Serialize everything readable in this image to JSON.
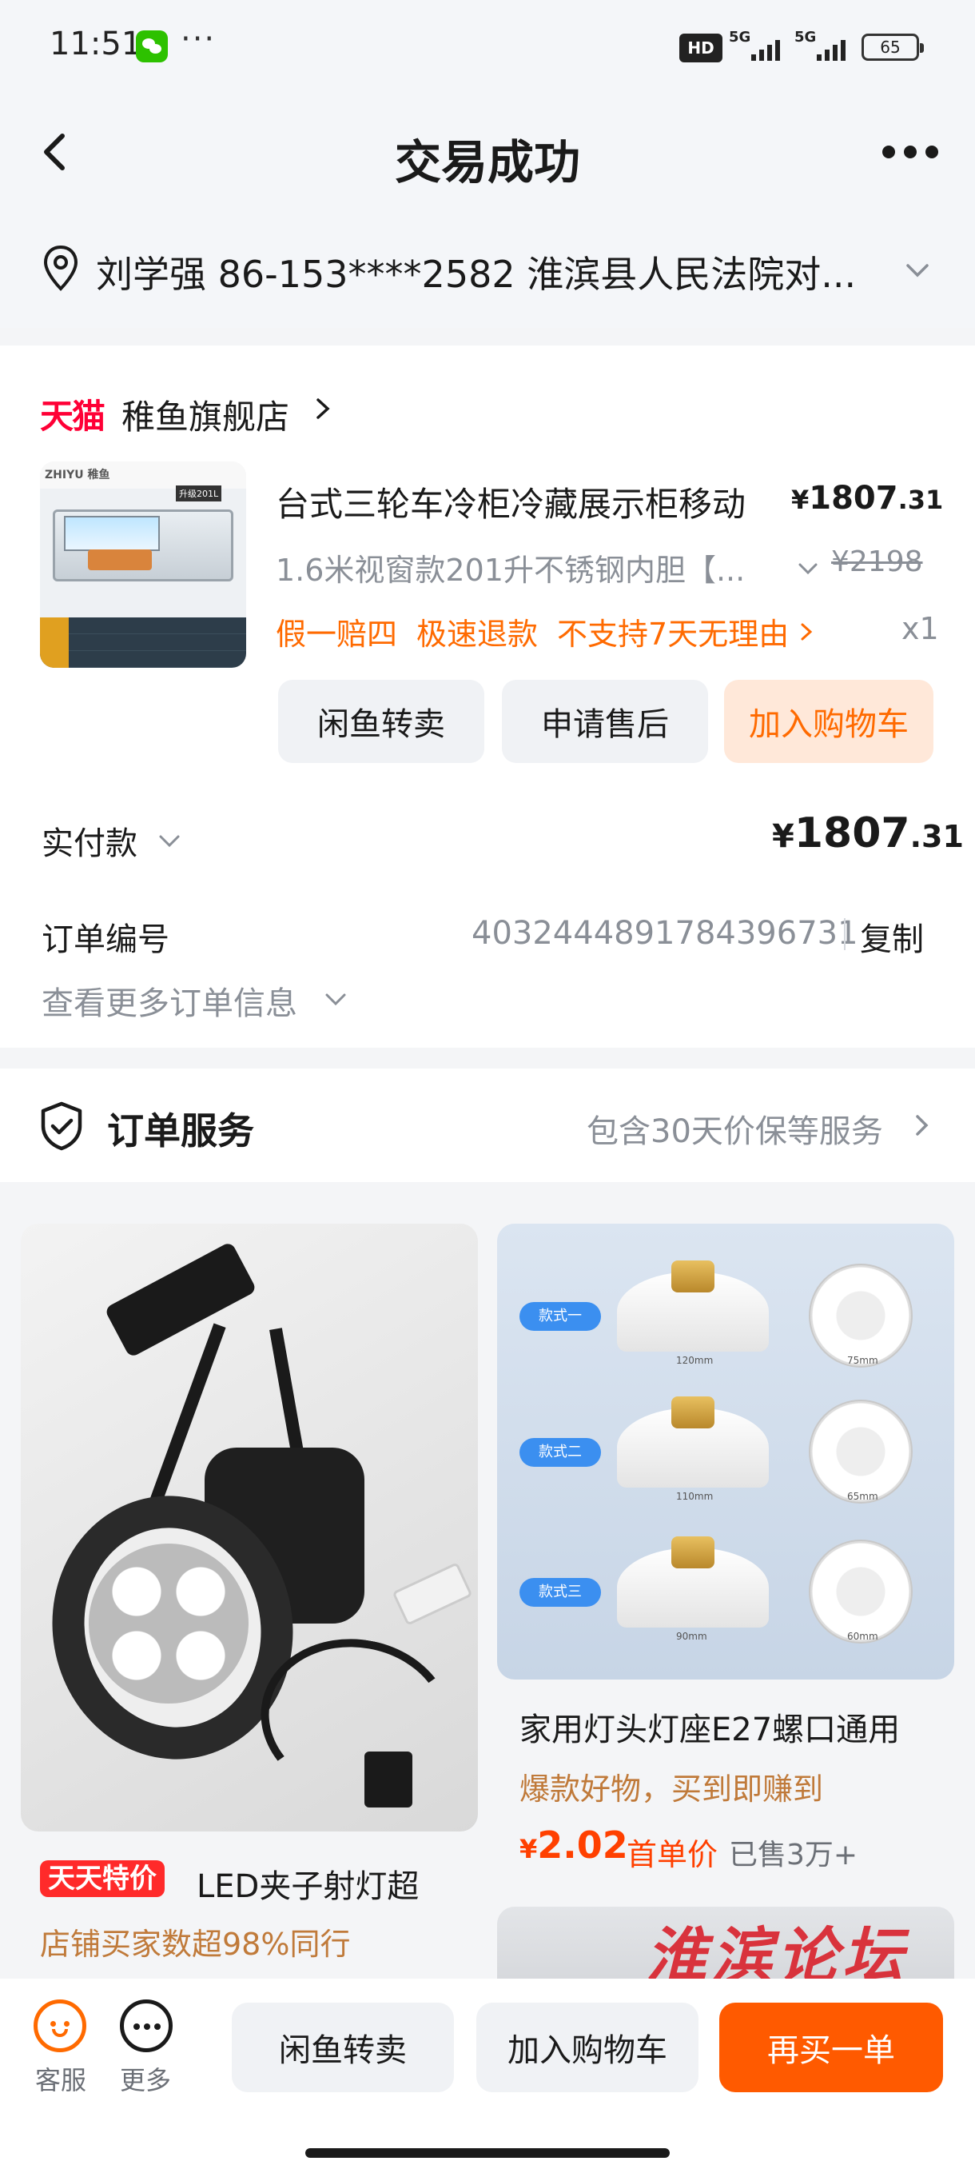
{
  "status_bar": {
    "time": "11:51",
    "dots": "···",
    "hd": "HD",
    "signal1": "5G",
    "signal2": "5G",
    "battery": "65"
  },
  "header": {
    "title": "交易成功",
    "back_icon": "chevron-left-icon",
    "more_icon": "more-horizontal-icon"
  },
  "address": {
    "text": "刘学强  86-153****2582  淮滨县人民法院对..."
  },
  "order": {
    "shop_logo": "天猫",
    "shop_name": "稚鱼旗舰店",
    "thumb_brand": "ZHIYU 稚鱼",
    "thumb_tag": "升级201L",
    "product_title": "台式三轮车冷柜冷藏展示柜移动",
    "price_currency": "¥",
    "price_int": "1807",
    "price_dec": ".31",
    "spec": "1.6米视窗款201升不锈钢内胆【...",
    "original_price": "¥2198",
    "guarantees": [
      "假一赔四",
      "极速退款",
      "不支持7天无理由"
    ],
    "quantity": "x1",
    "buttons": {
      "resell": "闲鱼转卖",
      "after_sale": "申请售后",
      "add_cart": "加入购物车"
    },
    "paid_label": "实付款",
    "paid_currency": "¥",
    "paid_int": "1807",
    "paid_dec": ".31",
    "order_no_label": "订单编号",
    "order_no": "4032444891784396731",
    "copy": "复制",
    "more_info": "查看更多订单信息"
  },
  "service": {
    "title": "订单服务",
    "desc": "包含30天价保等服务"
  },
  "recommendations": [
    {
      "badge": "天天特价",
      "title": "LED夹子射灯超",
      "subtitle": "店铺买家数超98%同行"
    },
    {
      "title": "家用灯头灯座E27螺口通用",
      "subtitle": "爆款好物，买到即赚到",
      "price_currency": "¥",
      "price": "2.02",
      "first_price_label": "首单价",
      "sold": "已售3万+",
      "styles": [
        "款式一",
        "款式二",
        "款式三"
      ],
      "dims": [
        "120mm",
        "75mm",
        "110mm",
        "65mm",
        "90mm",
        "60mm"
      ]
    }
  ],
  "watermark": "淮滨论坛",
  "bottom_bar": {
    "customer_service": "客服",
    "more": "更多",
    "resell": "闲鱼转卖",
    "add_cart": "加入购物车",
    "buy_again": "再买一单"
  },
  "colors": {
    "accent": "#ff6a00",
    "tmall_red": "#ff0036",
    "primary_button": "#ff5a00"
  }
}
